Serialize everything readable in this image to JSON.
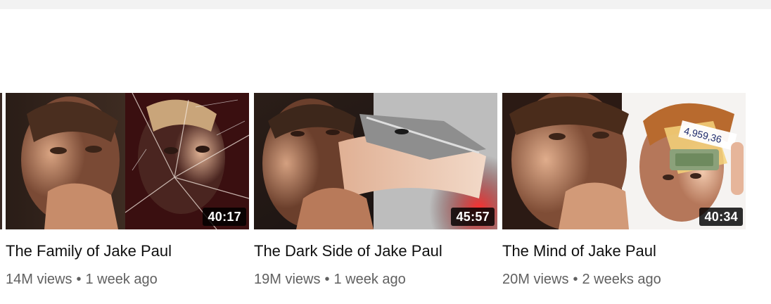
{
  "videos": [
    {
      "title": "The Family of Jake Paul",
      "duration": "40:17",
      "views": "14M views",
      "age": "1 week ago",
      "separator": "•"
    },
    {
      "title": "The Dark Side of Jake Paul",
      "duration": "45:57",
      "views": "19M views",
      "age": "1 week ago",
      "separator": "•"
    },
    {
      "title": "The Mind of Jake Paul",
      "duration": "40:34",
      "views": "20M views",
      "age": "2 weeks ago",
      "separator": "•"
    }
  ],
  "thumbnails": [
    {
      "description_icon": "thumbnail-image",
      "caption_text": ""
    },
    {
      "description_icon": "thumbnail-image",
      "caption_text": ""
    },
    {
      "description_icon": "thumbnail-image",
      "caption_text": "4,959,36"
    }
  ],
  "colors": {
    "title": "#0f0f0f",
    "meta": "#606060",
    "duration_bg": "#000000",
    "duration_text": "#ffffff",
    "page_bg": "#ffffff",
    "top_strip": "#f2f2f2"
  }
}
